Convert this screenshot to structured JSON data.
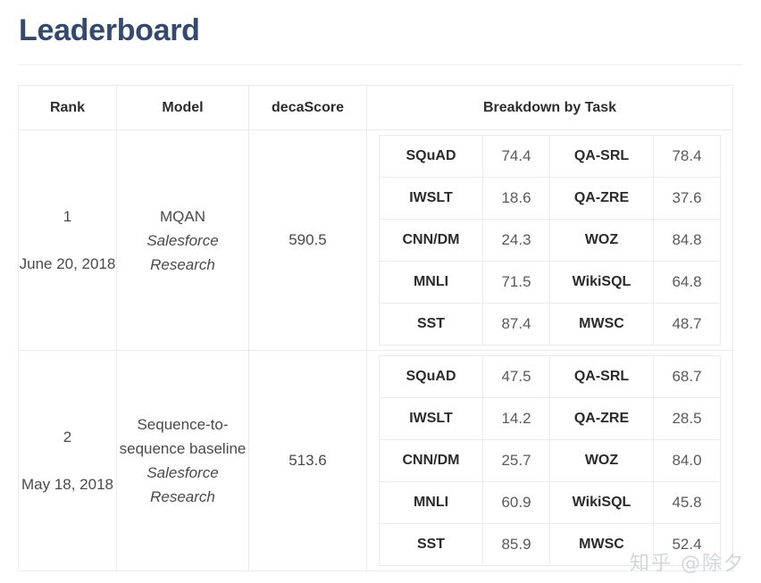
{
  "page": {
    "title": "Leaderboard",
    "watermark": "知乎 @除夕"
  },
  "table": {
    "columns": {
      "rank": "Rank",
      "model": "Model",
      "score": "decaScore",
      "breakdown": "Breakdown by Task"
    },
    "rows": [
      {
        "rank": "1",
        "date": "June 20, 2018",
        "model_name": "MQAN",
        "model_org": "Salesforce Research",
        "decascore": "590.5",
        "breakdown": [
          {
            "task_left": "SQuAD",
            "value_left": "74.4",
            "task_right": "QA-SRL",
            "value_right": "78.4"
          },
          {
            "task_left": "IWSLT",
            "value_left": "18.6",
            "task_right": "QA-ZRE",
            "value_right": "37.6"
          },
          {
            "task_left": "CNN/DM",
            "value_left": "24.3",
            "task_right": "WOZ",
            "value_right": "84.8"
          },
          {
            "task_left": "MNLI",
            "value_left": "71.5",
            "task_right": "WikiSQL",
            "value_right": "64.8"
          },
          {
            "task_left": "SST",
            "value_left": "87.4",
            "task_right": "MWSC",
            "value_right": "48.7"
          }
        ]
      },
      {
        "rank": "2",
        "date": "May 18, 2018",
        "model_name": "Sequence-to-sequence baseline",
        "model_org": "Salesforce Research",
        "decascore": "513.6",
        "breakdown": [
          {
            "task_left": "SQuAD",
            "value_left": "47.5",
            "task_right": "QA-SRL",
            "value_right": "68.7"
          },
          {
            "task_left": "IWSLT",
            "value_left": "14.2",
            "task_right": "QA-ZRE",
            "value_right": "28.5"
          },
          {
            "task_left": "CNN/DM",
            "value_left": "25.7",
            "task_right": "WOZ",
            "value_right": "84.0"
          },
          {
            "task_left": "MNLI",
            "value_left": "60.9",
            "task_right": "WikiSQL",
            "value_right": "45.8"
          },
          {
            "task_left": "SST",
            "value_left": "85.9",
            "task_right": "MWSC",
            "value_right": "52.4"
          }
        ]
      }
    ]
  },
  "colors": {
    "title": "#35496f",
    "border": "#ebebeb",
    "text": "#4a4a4a",
    "task_text": "#2b2b2b",
    "watermark": "#d2d6db"
  }
}
